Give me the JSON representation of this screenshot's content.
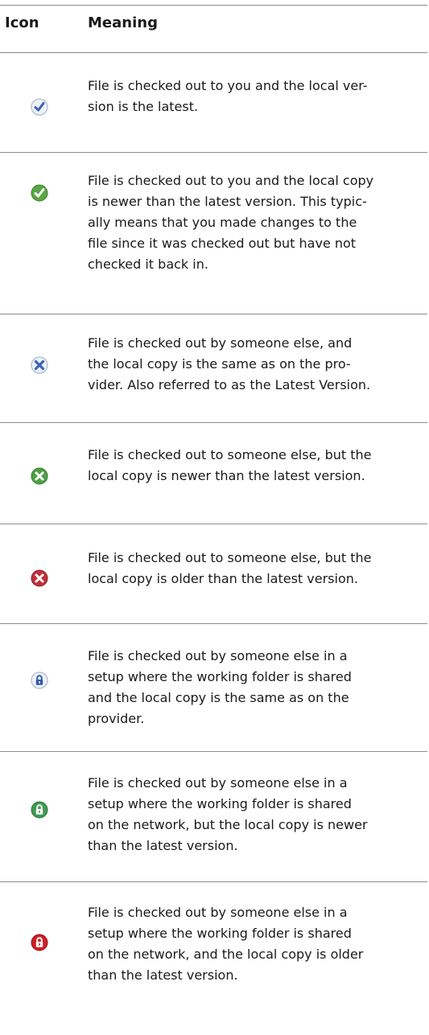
{
  "header": {
    "icon": "Icon",
    "meaning": "Meaning"
  },
  "rows": [
    {
      "icon": "checkmark-blue-icon",
      "color": "#3a63b8",
      "text": "File is checked out to you and the local ver-\nsion is the latest."
    },
    {
      "icon": "checkmark-green-icon",
      "color": "#5aa646",
      "text": "File is checked out to you and the local copy\nis newer than the latest version. This typic-\nally means that you made changes to the\nfile since it was checked out but have not\nchecked it back in."
    },
    {
      "icon": "x-blue-icon",
      "color": "#3a63b8",
      "text": "File is checked out by someone else, and\nthe local copy is the same as on the pro-\nvider. Also referred to as the Latest Version."
    },
    {
      "icon": "x-green-icon",
      "color": "#4e9f45",
      "text": "File is checked out to someone else, but the\nlocal copy is newer than the latest version."
    },
    {
      "icon": "x-red-icon",
      "color": "#c0313a",
      "text": "File is checked out to someone else, but the\nlocal copy is older than the latest version."
    },
    {
      "icon": "lock-blue-icon",
      "color": "#2f5aa6",
      "text": "File is checked out by someone else in a\nsetup where the working folder is shared\nand the local copy is the same as on the\nprovider."
    },
    {
      "icon": "lock-green-icon",
      "color": "#3f9a54",
      "text": "File is checked out by someone else in a\nsetup where the working folder is shared\non the network, but the local copy is newer\nthan the latest version."
    },
    {
      "icon": "lock-red-icon",
      "color": "#cc1f25",
      "text": "File is checked out by someone else in a\nsetup where the working folder is shared\non the network, and the local copy is older\nthan the latest version."
    }
  ]
}
